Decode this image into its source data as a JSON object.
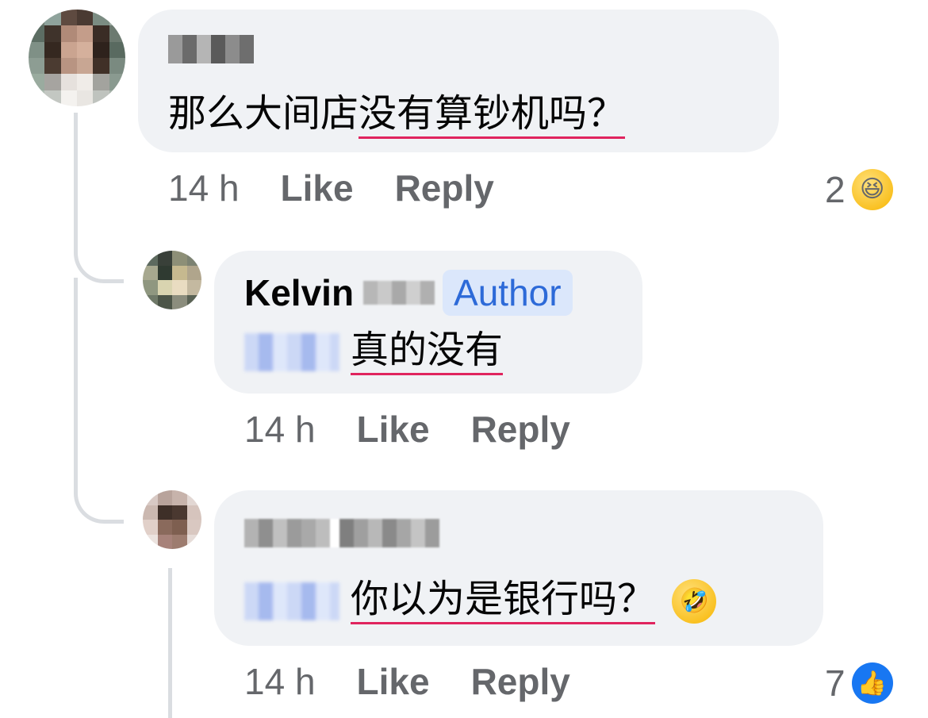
{
  "comments": [
    {
      "text_plain": "那么大间店",
      "text_underlined": "没有算钞机吗？",
      "time": "14 h",
      "like": "Like",
      "reply": "Reply",
      "reaction_count": "2",
      "reaction_icon": "laughing-emoji-icon"
    },
    {
      "name": "Kelvin",
      "badge": "Author",
      "text_underlined": "真的没有",
      "time": "14 h",
      "like": "Like",
      "reply": "Reply"
    },
    {
      "text_underlined": "你以为是银行吗？",
      "emoji": "rofl-emoji-icon",
      "time": "14 h",
      "like": "Like",
      "reply": "Reply",
      "reaction_count": "7",
      "reaction_icon": "thumbs-up-icon"
    }
  ]
}
